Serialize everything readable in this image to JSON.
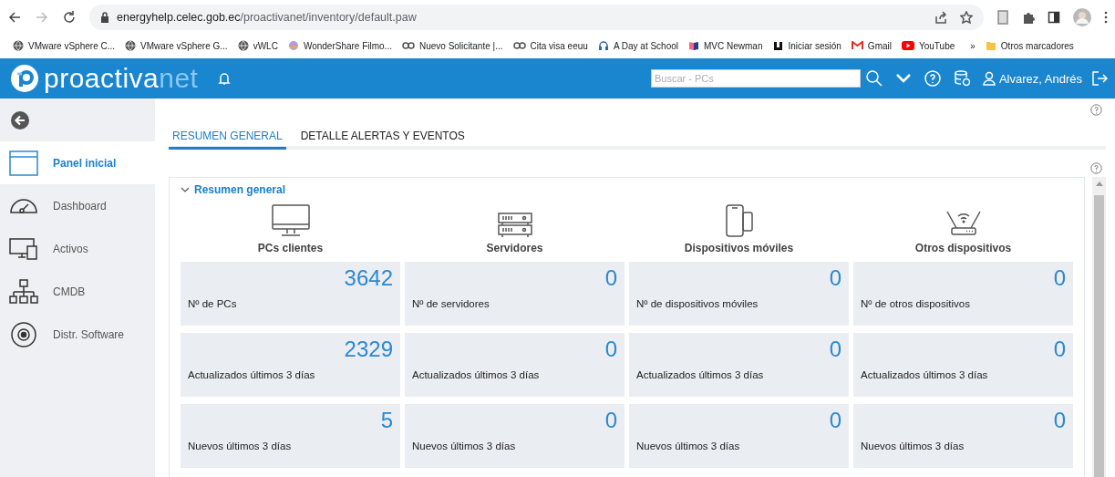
{
  "browser": {
    "url_host": "energyhelp.celec.gob.ec",
    "url_path": "/proactivanet/inventory/default.paw",
    "bookmarks": [
      {
        "label": "VMware vSphere C...",
        "kind": "globe"
      },
      {
        "label": "VMware vSphere G...",
        "kind": "globe"
      },
      {
        "label": "vWLC",
        "kind": "globe"
      },
      {
        "label": "WonderShare Filmo...",
        "kind": "badge"
      },
      {
        "label": "Nuevo Solicitante |...",
        "kind": "link"
      },
      {
        "label": "Cita visa eeuu",
        "kind": "link"
      },
      {
        "label": "A Day at School",
        "kind": "headphones"
      },
      {
        "label": "MVC Newman",
        "kind": "book"
      },
      {
        "label": "Iniciar sesión",
        "kind": "letter"
      },
      {
        "label": "Gmail",
        "kind": "mail"
      },
      {
        "label": "YouTube",
        "kind": "video"
      }
    ],
    "overflow": "»",
    "other_bookmarks": "Otros marcadores"
  },
  "header": {
    "logo_main": "proactiva",
    "logo_accent": "net",
    "search": {
      "placeholder": "Buscar - PCs"
    },
    "user": "Alvarez, Andrés"
  },
  "sidebar": {
    "items": [
      {
        "label": "Panel inicial",
        "kind": "panel",
        "selected": true
      },
      {
        "label": "Dashboard",
        "kind": "gauge",
        "selected": false
      },
      {
        "label": "Activos",
        "kind": "devices",
        "selected": false
      },
      {
        "label": "CMDB",
        "kind": "tree",
        "selected": false
      },
      {
        "label": "Distr. Software",
        "kind": "disc",
        "selected": false
      }
    ]
  },
  "tabs": [
    {
      "label": "RESUMEN GENERAL",
      "selected": true
    },
    {
      "label": "DETALLE ALERTAS Y EVENTOS",
      "selected": false
    }
  ],
  "section": {
    "title": "Resumen general",
    "expanded": true,
    "categories": [
      {
        "title": "PCs clientes",
        "kind": "pc",
        "metrics": [
          {
            "value": "3642",
            "label": "Nº de PCs"
          },
          {
            "value": "2329",
            "label": "Actualizados últimos 3 días"
          },
          {
            "value": "5",
            "label": "Nuevos últimos 3 días"
          }
        ]
      },
      {
        "title": "Servidores",
        "kind": "server",
        "metrics": [
          {
            "value": "0",
            "label": "Nº de servidores"
          },
          {
            "value": "0",
            "label": "Actualizados últimos 3 días"
          },
          {
            "value": "0",
            "label": "Nuevos últimos 3 días"
          }
        ]
      },
      {
        "title": "Dispositivos móviles",
        "kind": "mobile",
        "metrics": [
          {
            "value": "0",
            "label": "Nº de dispositivos móviles"
          },
          {
            "value": "0",
            "label": "Actualizados últimos 3 días"
          },
          {
            "value": "0",
            "label": "Nuevos últimos 3 días"
          }
        ]
      },
      {
        "title": "Otros dispositivos",
        "kind": "router",
        "metrics": [
          {
            "value": "0",
            "label": "Nº de otros dispositivos"
          },
          {
            "value": "0",
            "label": "Actualizados últimos 3 días"
          },
          {
            "value": "0",
            "label": "Nuevos últimos 3 días"
          }
        ]
      }
    ]
  }
}
